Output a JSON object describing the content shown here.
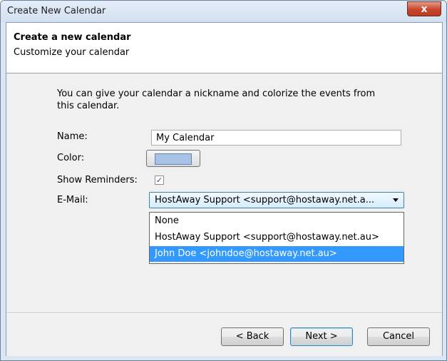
{
  "window": {
    "title": "Create New Calendar",
    "close_glyph": "x"
  },
  "header": {
    "title": "Create a new calendar",
    "subtitle": "Customize your calendar"
  },
  "form": {
    "intro": "You can give your calendar a nickname and colorize the events from this calendar.",
    "name_label": "Name:",
    "name_value": "My Calendar",
    "color_label": "Color:",
    "color_value": "#a6c2e6",
    "reminders_label": "Show Reminders:",
    "reminders_checked": true,
    "email_label": "E-Mail:",
    "email_selected": "HostAway Support <support@hostaway.net.a...",
    "email_options": [
      "None",
      "HostAway Support <support@hostaway.net.au>",
      "John Doe <johndoe@hostaway.net.au>"
    ],
    "highlighted_option": "John Doe <johndoe@hostaway.net.au>"
  },
  "buttons": {
    "back": "< Back",
    "next": "Next >",
    "cancel": "Cancel"
  },
  "colors": {
    "highlight": "#3399ff",
    "titlebar": "#d3e0f1",
    "close": "#c9452d"
  },
  "icons": {
    "close": "close-icon",
    "dropdown": "chevron-down-icon",
    "checkbox": "checkmark-icon"
  }
}
